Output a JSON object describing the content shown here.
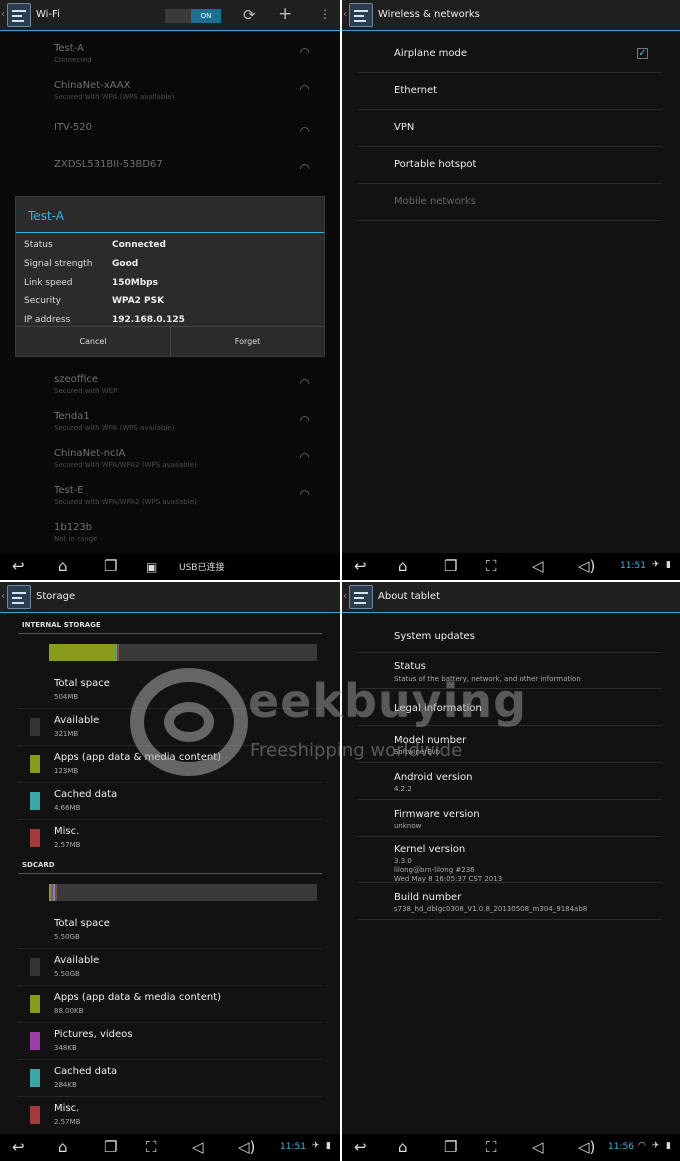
{
  "wifi_screen": {
    "title": "Wi-Fi",
    "toggle": "ON",
    "networks": [
      {
        "name": "Test-A",
        "status": "Connected"
      },
      {
        "name": "ChinaNet-xAAX",
        "status": "Secured with WPA (WPS available)"
      },
      {
        "name": "ITV-520",
        "status": ""
      },
      {
        "name": "ZXDSL531BII-53BD67",
        "status": ""
      },
      {
        "name": "szeoffice",
        "status": "Secured with WEP"
      },
      {
        "name": "Tenda1",
        "status": "Secured with WPA (WPS available)"
      },
      {
        "name": "ChinaNet-ncIA",
        "status": "Secured with WPA/WPA2 (WPS available)"
      },
      {
        "name": "Test-E",
        "status": "Secured with WPA/WPA2 (WPS available)"
      },
      {
        "name": "1b123b",
        "status": "Not in range"
      }
    ],
    "dialog": {
      "title": "Test-A",
      "rows": [
        {
          "label": "Status",
          "value": "Connected"
        },
        {
          "label": "Signal strength",
          "value": "Good"
        },
        {
          "label": "Link speed",
          "value": "150Mbps"
        },
        {
          "label": "Security",
          "value": "WPA2 PSK"
        },
        {
          "label": "IP address",
          "value": "192.168.0.125"
        }
      ],
      "cancel": "Cancel",
      "forget": "Forget"
    },
    "notification": "USB已连接"
  },
  "wireless_screen": {
    "title": "Wireless & networks",
    "items": [
      {
        "label": "Airplane mode",
        "checked": true
      },
      {
        "label": "Ethernet"
      },
      {
        "label": "VPN"
      },
      {
        "label": "Portable hotspot"
      },
      {
        "label": "Mobile networks",
        "disabled": true
      }
    ],
    "clock": "11:51"
  },
  "storage_screen": {
    "title": "Storage",
    "internal_header": "INTERNAL STORAGE",
    "internal_usage": [
      {
        "color": "#8a9a1a",
        "fraction": 0.245
      },
      {
        "color": "#3aa6a6",
        "fraction": 0.006
      },
      {
        "color": "#a33a3a",
        "fraction": 0.006
      }
    ],
    "internal": [
      {
        "label": "Total space",
        "value": "504MB",
        "color": ""
      },
      {
        "label": "Available",
        "value": "321MB",
        "color": "#333333"
      },
      {
        "label": "Apps (app data & media content)",
        "value": "123MB",
        "color": "#8a9a1a"
      },
      {
        "label": "Cached data",
        "value": "4.66MB",
        "color": "#3aa6a6"
      },
      {
        "label": "Misc.",
        "value": "2.57MB",
        "color": "#a33a3a"
      }
    ],
    "sdcard_header": "SDCARD",
    "sdcard_usage": [
      {
        "color": "#8a9a1a",
        "fraction": 0.005
      },
      {
        "color": "#9b3fa6",
        "fraction": 0.005
      },
      {
        "color": "#3aa6a6",
        "fraction": 0.005
      },
      {
        "color": "#a33a3a",
        "fraction": 0.005
      }
    ],
    "sdcard": [
      {
        "label": "Total space",
        "value": "5.50GB",
        "color": ""
      },
      {
        "label": "Available",
        "value": "5.50GB",
        "color": "#333333"
      },
      {
        "label": "Apps (app data & media content)",
        "value": "88.00KB",
        "color": "#8a9a1a"
      },
      {
        "label": "Pictures, videos",
        "value": "348KB",
        "color": "#9b3fa6"
      },
      {
        "label": "Cached data",
        "value": "284KB",
        "color": "#3aa6a6"
      },
      {
        "label": "Misc.",
        "value": "2.57MB",
        "color": "#a33a3a"
      }
    ],
    "clock": "11:51"
  },
  "about_screen": {
    "title": "About tablet",
    "items": [
      {
        "label": "System updates",
        "value": ""
      },
      {
        "label": "Status",
        "value": "Status of the battery, network, and other information"
      },
      {
        "label": "Legal information",
        "value": ""
      },
      {
        "label": "Model number",
        "value": "SoftwinerEvb"
      },
      {
        "label": "Android version",
        "value": "4.2.2"
      },
      {
        "label": "Firmware version",
        "value": "unknow"
      },
      {
        "label": "Kernel version",
        "value": "3.3.0\nlilong@brn-lilong #236\nWed May 8 16:05:37 CST 2013"
      },
      {
        "label": "Build number",
        "value": "s738_hd_dblgc0308_V1.0.8_20130508_m304_9184ab8"
      }
    ],
    "clock": "11:56"
  },
  "watermark": {
    "brand": "eekbuying",
    "tagline": "Freeshipping worldwide"
  }
}
